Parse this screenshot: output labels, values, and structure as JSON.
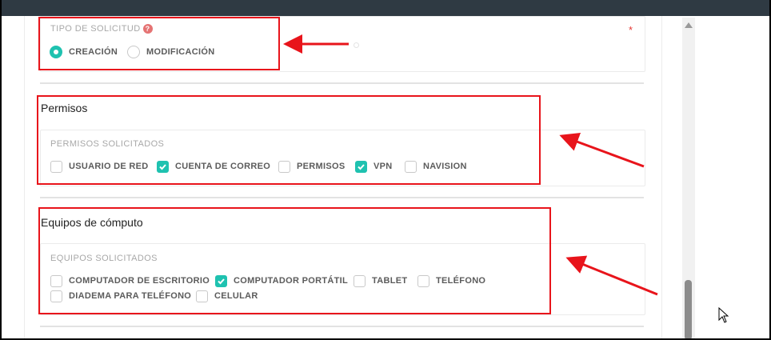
{
  "colors": {
    "accent": "#1fc2b0",
    "annotation_red": "#e8141b",
    "required_red": "#e53935",
    "label_gray": "#a8a8a8",
    "option_text": "#5b5b5b",
    "topbar": "#2f3a43"
  },
  "tipo_solicitud": {
    "label": "TIPO DE SOLICITUD",
    "help_icon": "question-circle-icon",
    "help_glyph": "?",
    "required_mark": "*",
    "options": [
      {
        "label": "CREACIÓN",
        "selected": true
      },
      {
        "label": "MODIFICACIÓN",
        "selected": false
      }
    ]
  },
  "permisos": {
    "title": "Permisos",
    "label": "PERMISOS SOLICITADOS",
    "options": [
      {
        "label": "USUARIO DE RED",
        "checked": false
      },
      {
        "label": "CUENTA DE CORREO",
        "checked": true
      },
      {
        "label": "PERMISOS",
        "checked": false
      },
      {
        "label": "VPN",
        "checked": true
      },
      {
        "label": "NAVISION",
        "checked": false
      }
    ]
  },
  "equipos": {
    "title": "Equipos de cómputo",
    "label": "EQUIPOS SOLICITADOS",
    "options": [
      {
        "label": "COMPUTADOR DE ESCRITORIO",
        "checked": false
      },
      {
        "label": "COMPUTADOR PORTÁTIL",
        "checked": true
      },
      {
        "label": "TABLET",
        "checked": false
      },
      {
        "label": "TELÉFONO",
        "checked": false
      },
      {
        "label": "DIADEMA PARA TELÉFONO",
        "checked": false
      },
      {
        "label": "CELULAR",
        "checked": false
      }
    ]
  },
  "annotations": {
    "arrow_icon": "red-arrow-icon",
    "box_icon": "red-highlight-box"
  }
}
